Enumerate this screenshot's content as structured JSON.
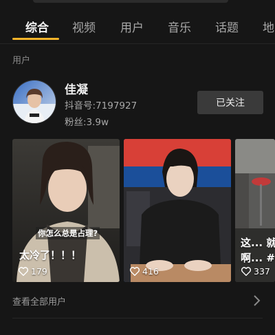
{
  "tabs": [
    {
      "label": "综合",
      "active": true
    },
    {
      "label": "视频",
      "active": false
    },
    {
      "label": "用户",
      "active": false
    },
    {
      "label": "音乐",
      "active": false
    },
    {
      "label": "话题",
      "active": false
    },
    {
      "label": "地",
      "active": false
    }
  ],
  "section": {
    "label": "用户"
  },
  "user": {
    "name": "佳凝",
    "douyin_id": "抖音号:7197927",
    "fans": "粉丝:3.9w",
    "follow_label": "已关注"
  },
  "cards": [
    {
      "caption": "太冷了！！！",
      "overlay": "你怎么总是占理?",
      "likes": "179"
    },
    {
      "caption": "",
      "overlay": "",
      "likes": "416"
    },
    {
      "caption": "这... 就是",
      "caption2": "啊... #电",
      "overlay": "",
      "likes": "337"
    }
  ],
  "footer": {
    "see_all": "查看全部用户"
  },
  "colors": {
    "accent": "#f7b52a",
    "background": "#161616",
    "button": "#3a3a3a"
  },
  "icons": {
    "heart": "heart-icon",
    "chevron": "chevron-right-icon"
  }
}
